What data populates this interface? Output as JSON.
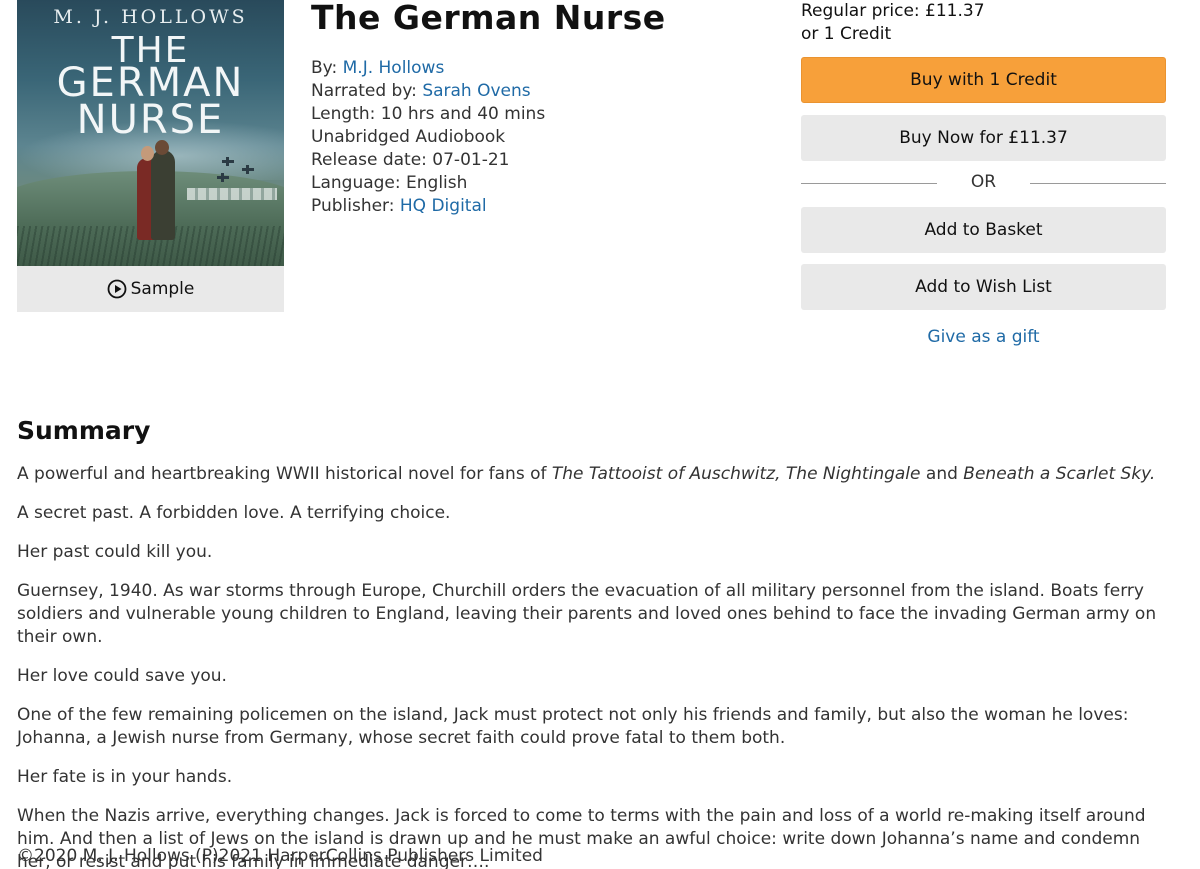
{
  "cover": {
    "author": "M. J. HOLLOWS",
    "title_line1": "THE",
    "title_line2": "GERMAN",
    "title_line3": "NURSE"
  },
  "sample": {
    "label": "Sample",
    "icon": "play-circle-icon"
  },
  "book": {
    "title": "The German Nurse",
    "by_label": "By:",
    "author": "M.J. Hollows",
    "narrated_label": "Narrated by:",
    "narrator": "Sarah Ovens",
    "length_label": "Length:",
    "length": "10 hrs and 40 mins",
    "format": "Unabridged Audiobook",
    "release_label": "Release date:",
    "release_date": "07-01-21",
    "language_label": "Language:",
    "language": "English",
    "publisher_label": "Publisher:",
    "publisher": "HQ Digital"
  },
  "purchase": {
    "regular_price": "Regular price: £11.37",
    "credit_line": "or 1 Credit",
    "buy_credit": "Buy with 1 Credit",
    "buy_now": "Buy Now for £11.37",
    "or": "OR",
    "add_basket": "Add to Basket",
    "add_wishlist": "Add to Wish List",
    "gift": "Give as a gift"
  },
  "summary": {
    "heading": "Summary",
    "p1_start": "A powerful and heartbreaking WWII historical novel for fans of ",
    "p1_title1": "The Tattooist of Auschwitz, The Nightingale",
    "p1_and": " and ",
    "p1_title2": "Beneath a Scarlet Sky.",
    "p2": "A secret past. A forbidden love. A terrifying choice.",
    "p3": "Her past could kill you.",
    "p4": "Guernsey, 1940. As war storms through Europe, Churchill orders the evacuation of all military personnel from the island. Boats ferry soldiers and vulnerable young children to England, leaving their parents and loved ones behind to face the invading German army on their own.",
    "p5": "Her love could save you.",
    "p6": "One of the few remaining policemen on the island, Jack must protect not only his friends and family, but also the woman he loves: Johanna, a Jewish nurse from Germany, whose secret faith could prove fatal to them both.",
    "p7": "Her fate is in your hands.",
    "p8": "When the Nazis arrive, everything changes. Jack is forced to come to terms with the pain and loss of a world re-making itself around him. And then a list of Jews on the island is drawn up and he must make an awful choice: write down Johanna’s name and condemn her, or resist and put his family in immediate danger….",
    "copyright": "©2020 M. J. Hollows (P)2021 HarperCollins Publishers Limited"
  },
  "colors": {
    "link": "#1f6aa6",
    "primary_button": "#f7a03a",
    "secondary_button": "#e9e9e9"
  }
}
